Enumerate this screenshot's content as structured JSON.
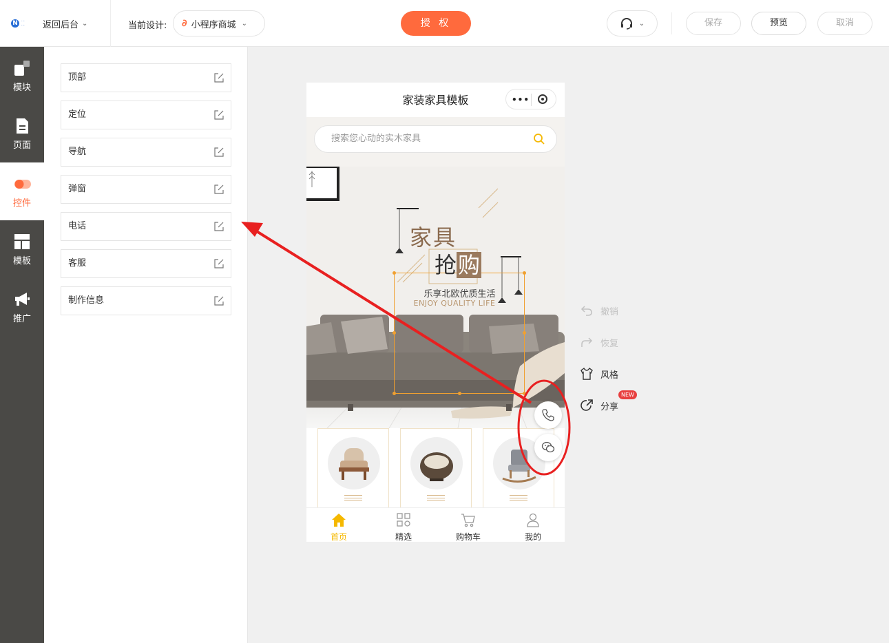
{
  "header": {
    "back_label": "返回后台",
    "current_design_label": "当前设计:",
    "design_name": "小程序商城",
    "auth_label": "授 权",
    "save_label": "保存",
    "preview_label": "预览",
    "cancel_label": "取消"
  },
  "leftnav": {
    "items": [
      {
        "label": "模块",
        "icon": "module-icon"
      },
      {
        "label": "页面",
        "icon": "page-icon"
      },
      {
        "label": "控件",
        "icon": "toggle-icon"
      },
      {
        "label": "模板",
        "icon": "template-icon"
      },
      {
        "label": "推广",
        "icon": "megaphone-icon"
      }
    ],
    "active_index": 2
  },
  "components": {
    "items": [
      "顶部",
      "定位",
      "导航",
      "弹窗",
      "电话",
      "客服",
      "制作信息"
    ]
  },
  "phone": {
    "title": "家装家具模板",
    "search_placeholder": "搜索您心动的实木家具",
    "banner": {
      "line1": "家具",
      "line2_plain": "抢",
      "line2_boxed": "购",
      "subtitle": "乐享北欧优质生活",
      "english": "ENJOY QUALITY LIFE"
    },
    "tabs": [
      {
        "label": "首页",
        "icon": "home-icon",
        "active": true
      },
      {
        "label": "精选",
        "icon": "grid-icon",
        "active": false
      },
      {
        "label": "购物车",
        "icon": "cart-icon",
        "active": false
      },
      {
        "label": "我的",
        "icon": "user-icon",
        "active": false
      }
    ]
  },
  "tools": {
    "undo_label": "撤销",
    "redo_label": "恢复",
    "style_label": "风格",
    "share_label": "分享",
    "new_badge": "NEW"
  },
  "colors": {
    "accent": "#ff6a3d",
    "nav_bg": "#4a4946",
    "tab_active": "#f5b800",
    "annotation_red": "#e82020"
  }
}
